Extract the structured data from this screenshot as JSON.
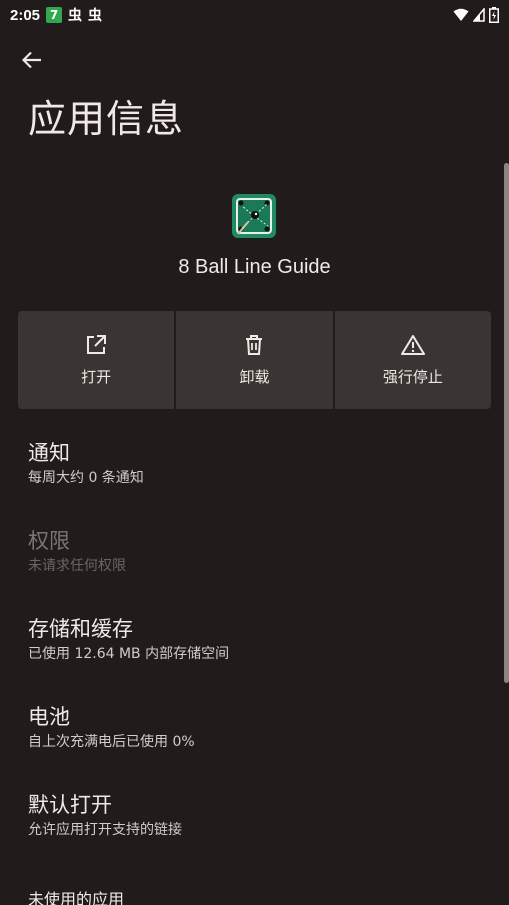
{
  "status_bar": {
    "time": "2:05",
    "notif_badge": "7",
    "bug1": "虫",
    "bug2": "虫"
  },
  "header": {
    "title": "应用信息"
  },
  "app": {
    "name": "8 Ball Line Guide",
    "icon": "billiards-table-icon"
  },
  "actions": [
    {
      "label": "打开",
      "icon": "open-external-icon"
    },
    {
      "label": "卸载",
      "icon": "trash-icon"
    },
    {
      "label": "强行停止",
      "icon": "warning-icon"
    }
  ],
  "settings": [
    {
      "title": "通知",
      "subtitle": "每周大约 0 条通知",
      "enabled": true
    },
    {
      "title": "权限",
      "subtitle": "未请求任何权限",
      "enabled": false
    },
    {
      "title": "存储和缓存",
      "subtitle": "已使用 12.64 MB 内部存储空间",
      "enabled": true
    },
    {
      "title": "电池",
      "subtitle": "自上次充满电后已使用 0%",
      "enabled": true
    },
    {
      "title": "默认打开",
      "subtitle": "允许应用打开支持的链接",
      "enabled": true
    }
  ],
  "section": {
    "unused_apps": "未使用的应用"
  },
  "colors": {
    "background": "#211c1b",
    "button_bg": "#3a3533",
    "text_primary": "#f2e9e6",
    "text_disabled": "#7b7472",
    "app_icon_green": "#1f8a63"
  }
}
